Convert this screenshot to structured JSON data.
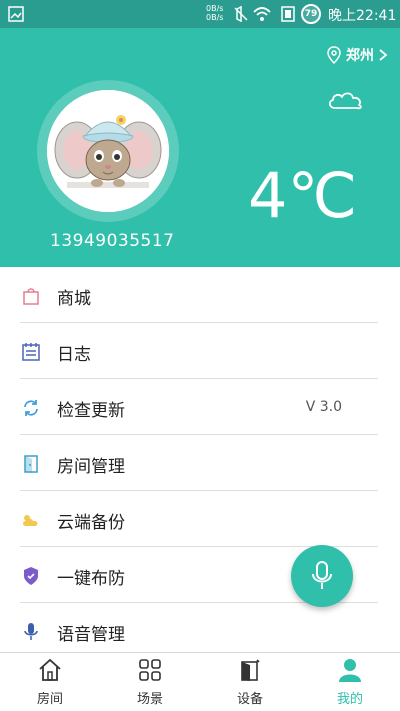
{
  "status_bar": {
    "speed_up": "0B/s",
    "speed_down": "0B/s",
    "battery": "79",
    "time": "晚上22:41"
  },
  "header": {
    "location": "郑州",
    "phone": "13949035517",
    "weather_icon": "cloud-icon",
    "temperature": "4℃"
  },
  "menu": [
    {
      "label": "商城",
      "icon": "shopping-bag-icon",
      "value": ""
    },
    {
      "label": "日志",
      "icon": "log-icon",
      "value": ""
    },
    {
      "label": "检查更新",
      "icon": "refresh-icon",
      "value": "V 3.0"
    },
    {
      "label": "房间管理",
      "icon": "door-icon",
      "value": ""
    },
    {
      "label": "云端备份",
      "icon": "cloud-backup-icon",
      "value": ""
    },
    {
      "label": "一键布防",
      "icon": "shield-icon",
      "value": ""
    },
    {
      "label": "语音管理",
      "icon": "microphone-icon",
      "value": ""
    }
  ],
  "bottom_nav": [
    {
      "label": "房间",
      "icon": "home-icon",
      "active": false
    },
    {
      "label": "场景",
      "icon": "scene-grid-icon",
      "active": false
    },
    {
      "label": "设备",
      "icon": "device-icon",
      "active": false
    },
    {
      "label": "我的",
      "icon": "user-icon",
      "active": true
    }
  ],
  "colors": {
    "accent": "#2fbfaa",
    "status_bar": "#2a9d90"
  }
}
